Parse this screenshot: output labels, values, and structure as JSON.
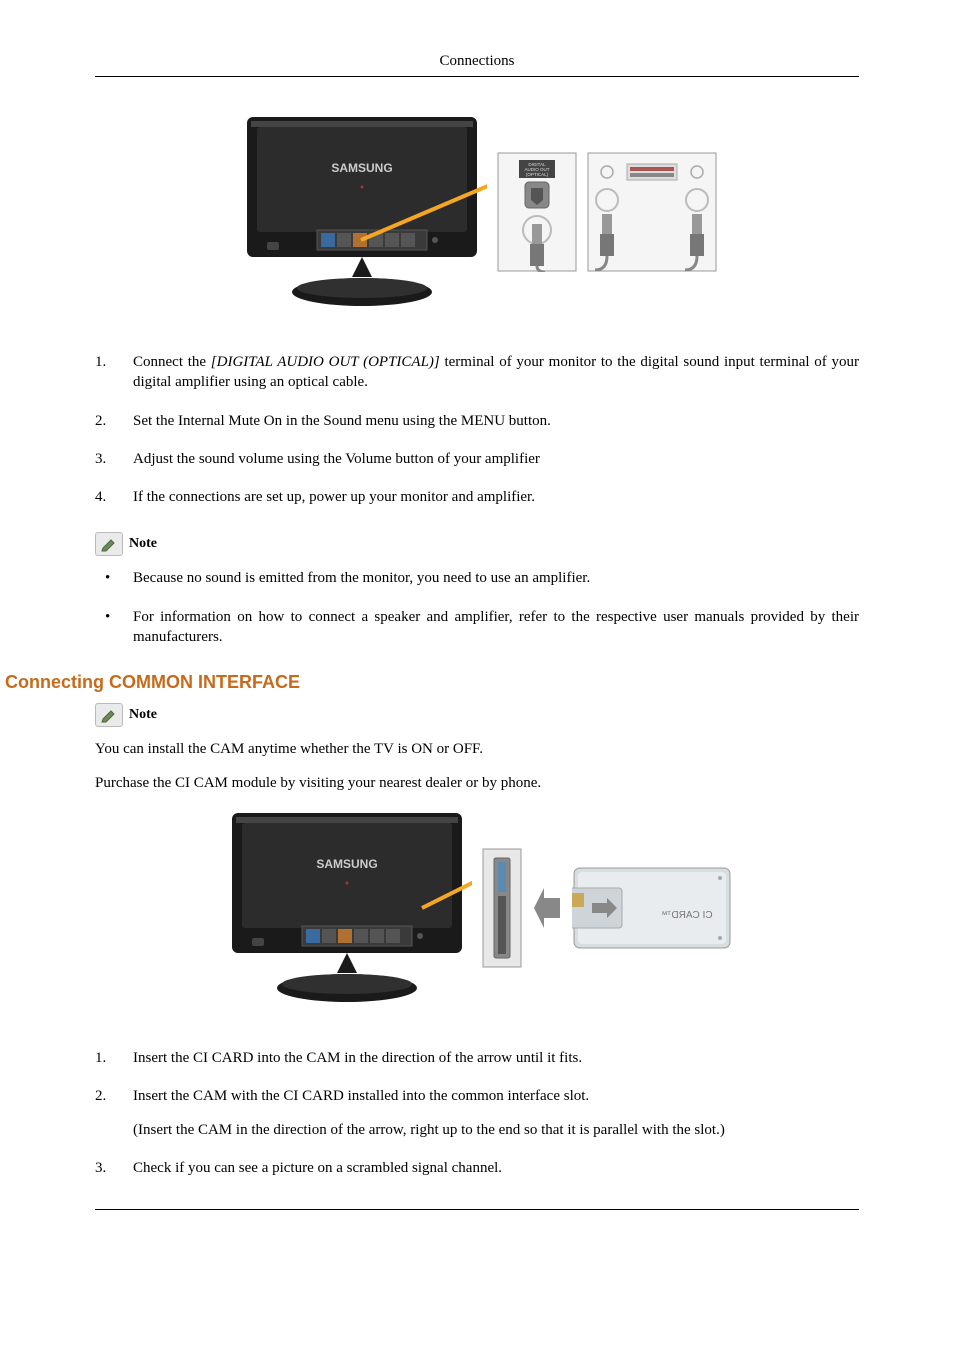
{
  "header": {
    "title": "Connections"
  },
  "figure1": {
    "brand": "SAMSUNG",
    "port_label": "DIGITAL\nAUDIO OUT\n(OPTICAL)"
  },
  "list1": {
    "i1_pre": "Connect the ",
    "i1_em": "[DIGITAL AUDIO OUT (OPTICAL)]",
    "i1_post": " terminal of your monitor to the digital sound input terminal of your digital amplifier using an optical cable.",
    "i2": "Set the Internal Mute On in the Sound menu using the MENU button.",
    "i3": "Adjust the sound volume using the Volume button of your amplifier",
    "i4": "If the connections are set up, power up your monitor and amplifier."
  },
  "note_label": "Note",
  "bullets1": {
    "b1": "Because no sound is emitted from the monitor, you need to use an amplifier.",
    "b2": "For information on how to connect a speaker and amplifier, refer to the respective user manuals provided by their manufacturers."
  },
  "section2": {
    "heading": "Connecting COMMON INTERFACE"
  },
  "para1": "You can install the CAM anytime whether the TV is ON or OFF.",
  "para2": "Purchase the CI CAM module by visiting your nearest dealer or by phone.",
  "figure2": {
    "brand": "SAMSUNG",
    "card_label": "CI CARD™"
  },
  "list2": {
    "i1": "Insert the CI CARD into the CAM in the direction of the arrow until it fits.",
    "i2": "Insert the CAM with the CI CARD installed into the common interface slot.",
    "i2_sub": "(Insert the CAM in the direction of the arrow, right up to the end so that it is parallel with the slot.)",
    "i3": "Check if you can see a picture on a scrambled signal channel."
  }
}
